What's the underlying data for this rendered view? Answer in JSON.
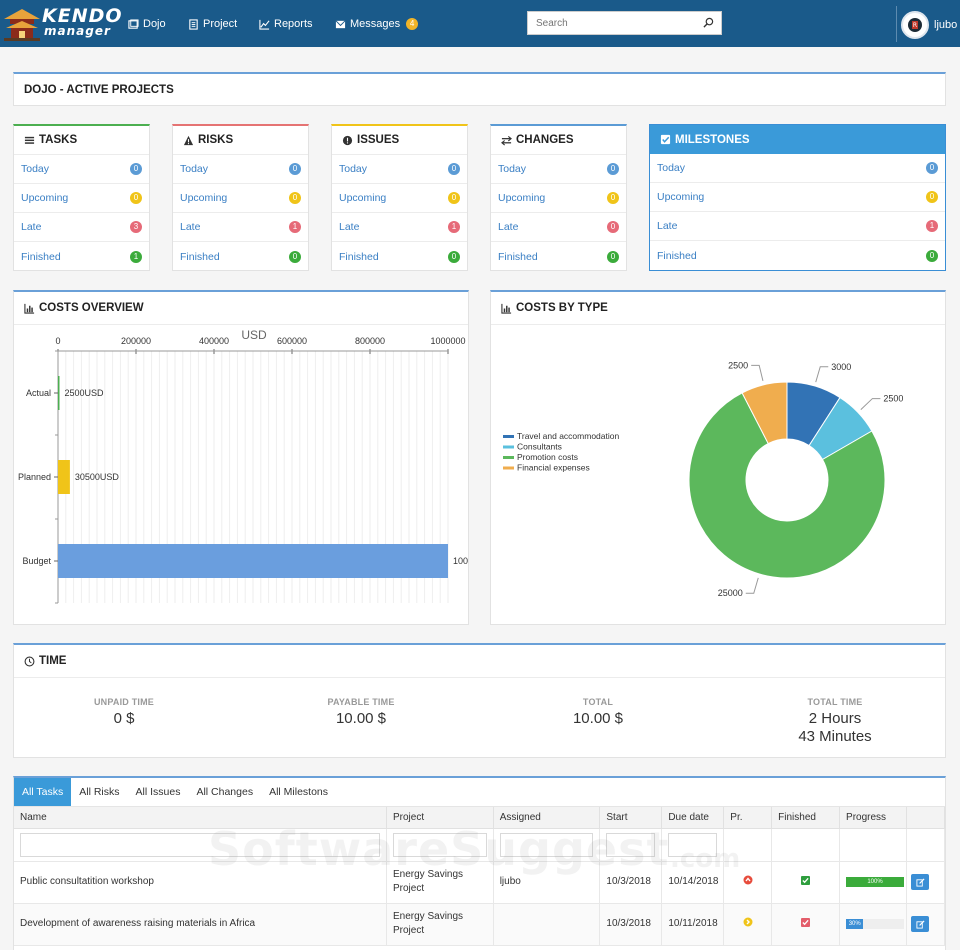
{
  "app": {
    "logo_line1": "KENDO",
    "logo_line2": "manager",
    "user": "ljubo",
    "messages_count": "4"
  },
  "nav": [
    {
      "label": "Dojo",
      "icon": "window-icon"
    },
    {
      "label": "Project",
      "icon": "document-icon"
    },
    {
      "label": "Reports",
      "icon": "line-chart-icon"
    },
    {
      "label": "Messages",
      "icon": "envelope-icon"
    }
  ],
  "search": {
    "placeholder": "Search",
    "value": ""
  },
  "page_title": "DOJO - ACTIVE PROJECTS",
  "row_labels": [
    "Today",
    "Upcoming",
    "Late",
    "Finished"
  ],
  "stats": [
    {
      "title": "TASKS",
      "icon": "list-icon",
      "accent": "#4caf50",
      "counts": [
        "0",
        "0",
        "3",
        "1"
      ]
    },
    {
      "title": "RISKS",
      "icon": "warning-icon",
      "accent": "#e57373",
      "counts": [
        "0",
        "0",
        "1",
        "0"
      ]
    },
    {
      "title": "ISSUES",
      "icon": "exclamation-circle-icon",
      "accent": "#f0c419",
      "counts": [
        "0",
        "0",
        "1",
        "0"
      ]
    },
    {
      "title": "CHANGES",
      "icon": "exchange-icon",
      "accent": "#5b9bd5",
      "counts": [
        "0",
        "0",
        "0",
        "0"
      ]
    },
    {
      "title": "MILESTONES",
      "icon": "checkbox-icon",
      "accent": "#3a9ad9",
      "counts": [
        "0",
        "0",
        "1",
        "0"
      ]
    }
  ],
  "costs_overview": {
    "title": "COSTS OVERVIEW",
    "icon": "bar-chart-icon"
  },
  "costs_by_type": {
    "title": "COSTS BY TYPE",
    "icon": "bar-chart-icon"
  },
  "chart_data": [
    {
      "type": "bar",
      "orientation": "horizontal",
      "title": "USD",
      "categories": [
        "Actual",
        "Planned",
        "Budget"
      ],
      "values": [
        2500,
        30500,
        1000000
      ],
      "value_labels": [
        "2500USD",
        "30500USD",
        "100"
      ],
      "colors": [
        "#4caf50",
        "#f0c419",
        "#6a9ede"
      ],
      "xlim": [
        0,
        1000000
      ],
      "x_ticks": [
        "0",
        "200000",
        "400000",
        "600000",
        "800000",
        "1000000"
      ],
      "grid": true
    },
    {
      "type": "pie",
      "donut": true,
      "categories": [
        "Travel and accommodation",
        "Consultants",
        "Promotion costs",
        "Financial expenses"
      ],
      "values": [
        3000,
        2500,
        25000,
        2500
      ],
      "colors": [
        "#3273b5",
        "#5bc0de",
        "#5cb85c",
        "#f0ad4e"
      ],
      "legend": "left"
    }
  ],
  "time": {
    "title": "TIME",
    "icon": "clock-icon",
    "items": [
      {
        "label": "UNPAID TIME",
        "value": "0 $"
      },
      {
        "label": "PAYABLE TIME",
        "value": "10.00 $"
      },
      {
        "label": "TOTAL",
        "value": "10.00 $"
      },
      {
        "label": "TOTAL TIME",
        "value": "2 Hours",
        "value2": "43 Minutes"
      }
    ]
  },
  "tabs": [
    "All Tasks",
    "All Risks",
    "All Issues",
    "All Changes",
    "All Milestons"
  ],
  "table": {
    "headers": [
      "Name",
      "Project",
      "Assigned",
      "Start",
      "Due date",
      "Pr.",
      "Finished",
      "Progress",
      ""
    ],
    "rows": [
      {
        "name": "Public consultatition workshop",
        "project": "Energy Savings Project",
        "assigned": "ljubo",
        "start": "10/3/2018",
        "due": "10/14/2018",
        "priority": "high",
        "priority_color": "#e74c3c",
        "finished": true,
        "progress": 100,
        "progress_label": "100%"
      },
      {
        "name": "Development of awareness raising materials in Africa",
        "project": "Energy Savings Project",
        "assigned": "",
        "start": "10/3/2018",
        "due": "10/11/2018",
        "priority": "medium",
        "priority_color": "#f0c419",
        "finished": false,
        "progress": 30,
        "progress_label": "30%"
      }
    ]
  },
  "watermark": {
    "main": "SoftwareSuggest",
    "suffix": ".com"
  }
}
